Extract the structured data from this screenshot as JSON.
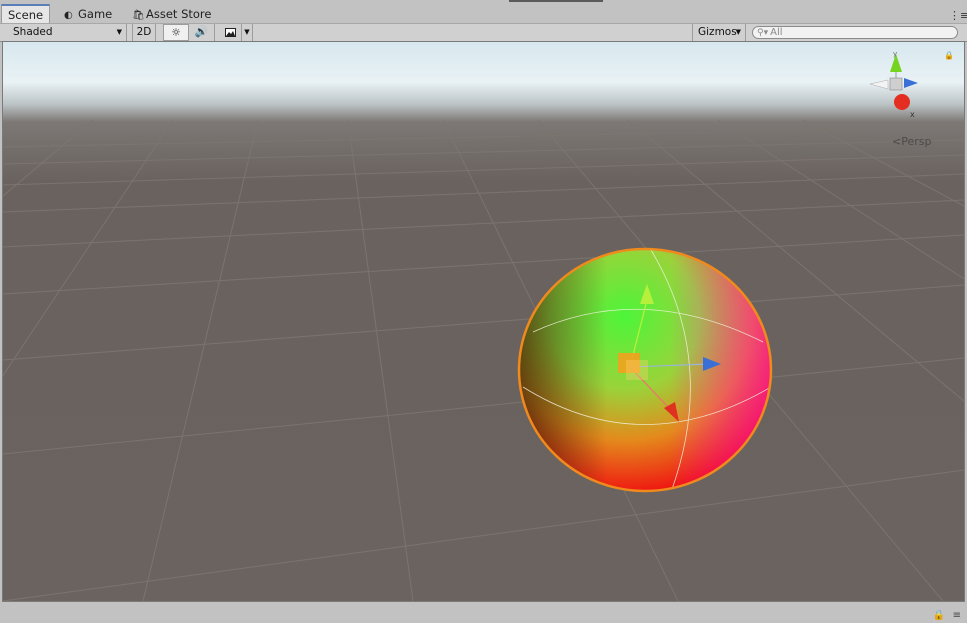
{
  "tabs": [
    {
      "label": "Scene",
      "icon": "scene-tab-icon",
      "active": true
    },
    {
      "label": "Game",
      "icon": "pacman-icon",
      "active": false
    },
    {
      "label": "Asset Store",
      "icon": "shopping-bag-icon",
      "active": false
    }
  ],
  "toolbar": {
    "shading_mode": "Shaded",
    "mode_2d": "2D",
    "lighting_icon": "sun-icon",
    "audio_icon": "speaker-icon",
    "effects_icon": "image-icon",
    "gizmos_label": "Gizmos",
    "search_placeholder": "All"
  },
  "viewport": {
    "projection_label": "Persp",
    "axis_x_label": "x",
    "axis_y_label": "y",
    "object": "sphere",
    "colors": {
      "sky": "#e9f2f5",
      "ground": "#69625e",
      "grid": "#7d7670",
      "selection_outline": "#f08a1d",
      "x_axis": "#d8271f",
      "y_axis": "#7fd222",
      "z_axis": "#3a6fd8"
    }
  }
}
